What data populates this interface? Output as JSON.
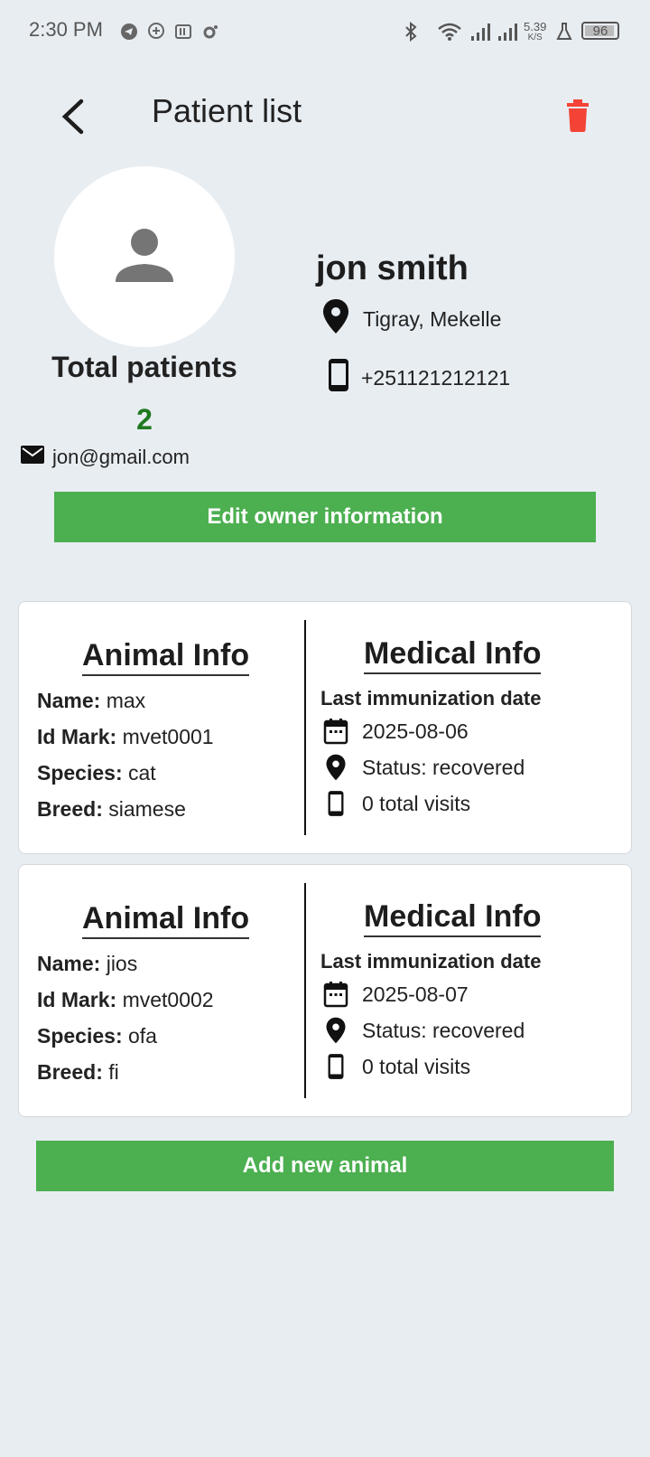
{
  "status_bar": {
    "time": "2:30 PM",
    "net_speed_value": "5.39",
    "net_speed_unit": "K/S",
    "battery": "96"
  },
  "header": {
    "title": "Patient list",
    "back_icon": "arrow-back-icon",
    "delete_icon": "trash-icon",
    "delete_color": "#f44336"
  },
  "owner": {
    "name": "jon smith",
    "location": "Tigray, Mekelle",
    "phone": "+251121212121",
    "email": "jon@gmail.com",
    "total_patients_label": "Total patients",
    "total_patients_count": "2",
    "count_color": "#1f7a1f"
  },
  "actions": {
    "edit_owner_label": "Edit owner information",
    "add_animal_label": "Add new animal",
    "accent": "#4caf50"
  },
  "animals": [
    {
      "animal_info_title": "Animal Info",
      "medical_info_title": "Medical Info",
      "name_label": "Name:",
      "name": "max",
      "id_label": "Id Mark:",
      "id_mark": "mvet0001",
      "species_label": "Species:",
      "species": "cat",
      "breed_label": "Breed:",
      "breed": "siamese",
      "last_immunization_label": "Last immunization date",
      "last_immunization_date": "2025-08-06",
      "status": "Status: recovered",
      "visits": "0 total visits"
    },
    {
      "animal_info_title": "Animal Info",
      "medical_info_title": "Medical Info",
      "name_label": "Name:",
      "name": "jios",
      "id_label": "Id Mark:",
      "id_mark": "mvet0002",
      "species_label": "Species:",
      "species": "ofa",
      "breed_label": "Breed:",
      "breed": "fi",
      "last_immunization_label": "Last immunization date",
      "last_immunization_date": "2025-08-07",
      "status": "Status: recovered",
      "visits": "0 total visits"
    }
  ]
}
